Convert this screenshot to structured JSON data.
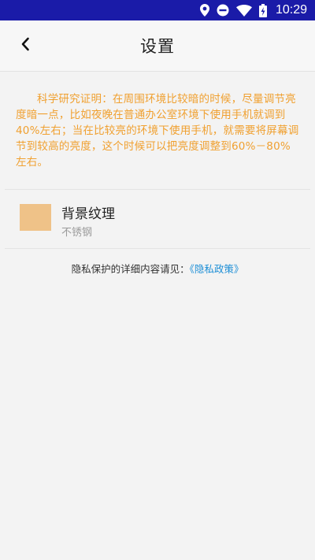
{
  "status_bar": {
    "time": "10:29",
    "icons": [
      "location-icon",
      "do-not-disturb-icon",
      "wifi-icon",
      "battery-charging-icon"
    ],
    "background": "#1a1ba8"
  },
  "header": {
    "title": "设置",
    "back_icon": "chevron-left-icon"
  },
  "notice": {
    "text": "科学研究证明：在周围环境比较暗的时候，尽量调节亮度暗一点，比如夜晚在普通办公室环境下使用手机就调到40%左右；当在比较亮的环境下使用手机，就需要将屏幕调节到较高的亮度，这个时候可以把亮度调整到60%－80%左右。",
    "color": "#f0a030"
  },
  "settings": {
    "background_texture": {
      "label": "背景纹理",
      "value": "不锈钢",
      "swatch_color": "#efc288"
    }
  },
  "privacy": {
    "text": "隐私保护的详细内容请见：",
    "link": "《隐私政策》",
    "link_color": "#1e8fd6"
  }
}
